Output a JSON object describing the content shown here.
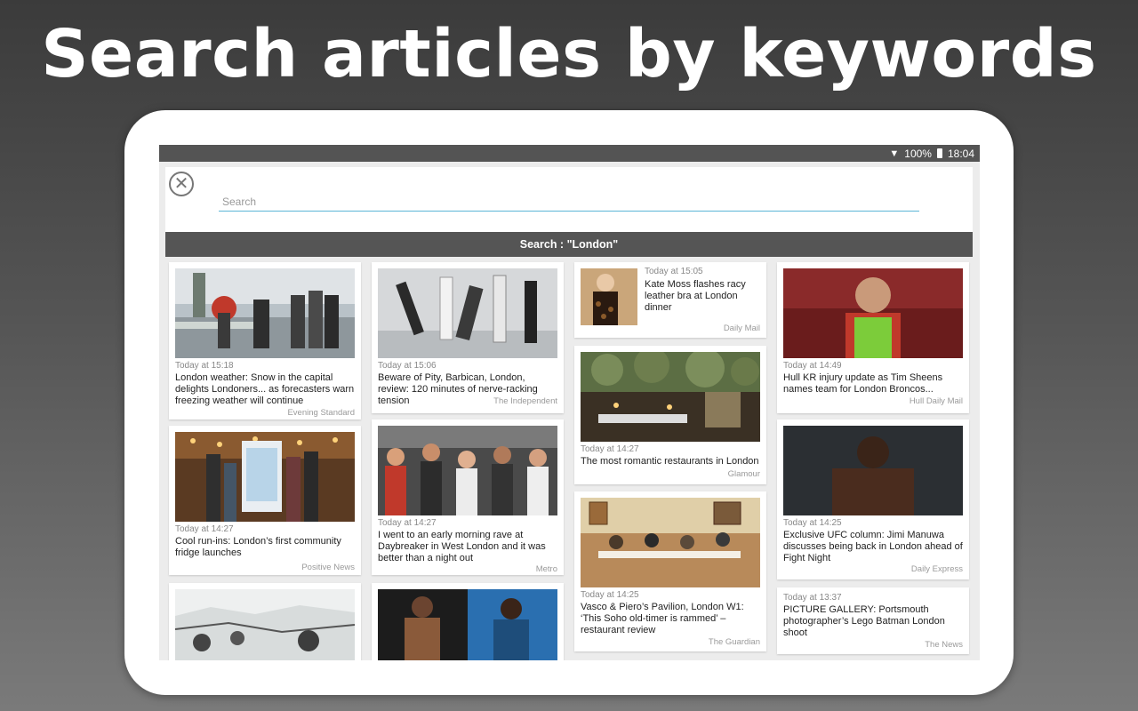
{
  "headline": "Search articles by keywords",
  "status": {
    "battery": "100%",
    "time": "18:04"
  },
  "search": {
    "placeholder": "Search",
    "results_label": "Search : \"London\""
  },
  "columns": [
    [
      {
        "time": "Today at 15:18",
        "title": "London weather: Snow in the capital delights Londoners... as forecasters warn freezing weather will continue",
        "source": "Evening Standard"
      },
      {
        "time": "Today at 14:27",
        "title": "Cool run-ins: London’s first community fridge launches",
        "source": "Positive News"
      },
      {
        "time": "",
        "title": "",
        "source": ""
      }
    ],
    [
      {
        "time": "Today at 15:06",
        "title": "Beware of Pity, Barbican, London, review: 120 minutes of nerve-racking tension",
        "source": "The Independent"
      },
      {
        "time": "Today at 14:27",
        "title": "I went to an early morning rave at Daybreaker in West London and it was better than a night out",
        "source": "Metro"
      },
      {
        "time": "",
        "title": "",
        "source": ""
      }
    ],
    [
      {
        "time": "Today at 15:05",
        "title": "Kate Moss flashes racy leather bra at London dinner",
        "source": "Daily Mail"
      },
      {
        "time": "Today at 14:27",
        "title": "The most romantic restaurants in London",
        "source": "Glamour"
      },
      {
        "time": "Today at 14:25",
        "title": "Vasco & Piero’s Pavilion, London W1: ‘This Soho old-timer is rammed’ – restaurant review",
        "source": "The Guardian"
      }
    ],
    [
      {
        "time": "Today at 14:49",
        "title": "Hull KR injury update as Tim Sheens names team for London Broncos...",
        "source": "Hull Daily Mail"
      },
      {
        "time": "Today at 14:25",
        "title": "Exclusive UFC column: Jimi Manuwa discusses being back in London ahead of Fight Night",
        "source": "Daily Express"
      },
      {
        "time": "Today at 13:37",
        "title": "PICTURE GALLERY: Portsmouth photographer’s Lego Batman London shoot",
        "source": "The News"
      }
    ]
  ]
}
